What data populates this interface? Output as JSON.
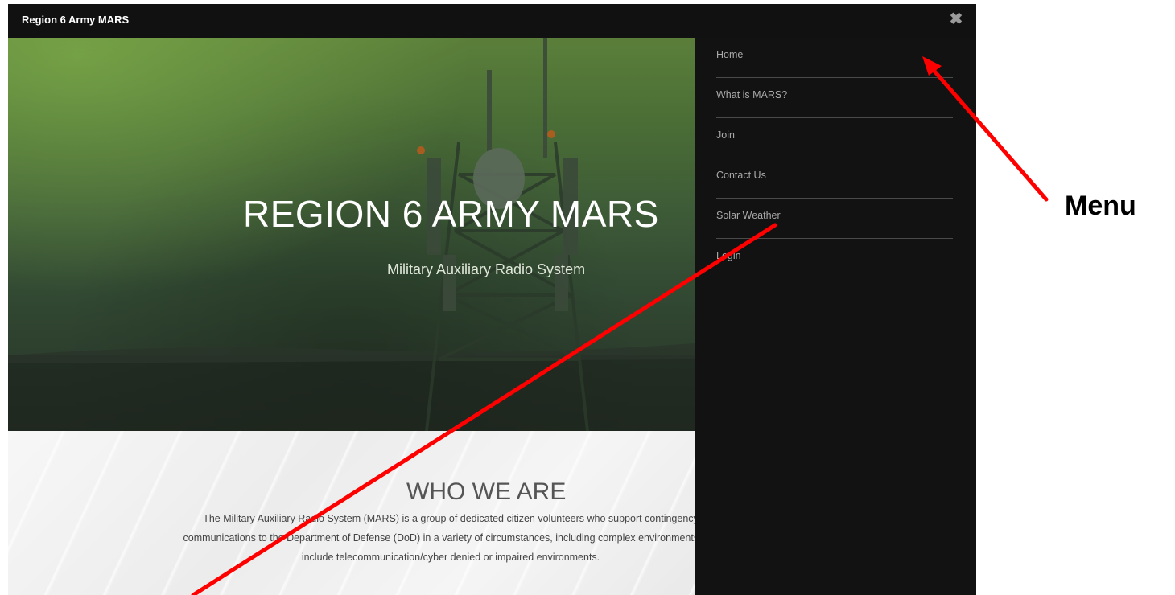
{
  "header": {
    "site_title": "Region 6 Army MARS",
    "close_icon": "close-icon"
  },
  "hero": {
    "title": "REGION 6 ARMY MARS",
    "subtitle": "Military Auxiliary Radio System"
  },
  "who_we_are": {
    "title": "WHO WE ARE",
    "lines": [
      "The Military Auxiliary Radio System (MARS) is a group of dedicated citizen volunteers who support contingency",
      "communications to the Department of Defense (DoD) in a variety of circumstances, including complex environments that",
      "include telecommunication/cyber denied or impaired environments."
    ]
  },
  "menu": {
    "items": [
      {
        "label": "Home"
      },
      {
        "label": "What is MARS?"
      },
      {
        "label": "Join"
      },
      {
        "label": "Contact Us"
      },
      {
        "label": "Solar Weather"
      },
      {
        "label": "Login"
      }
    ]
  },
  "annotation": {
    "label": "Menu",
    "arrow_color": "#ff0000"
  },
  "colors": {
    "topbar": "#111111",
    "menu_bg": "#121212",
    "hero_green": "#4a6d36"
  }
}
